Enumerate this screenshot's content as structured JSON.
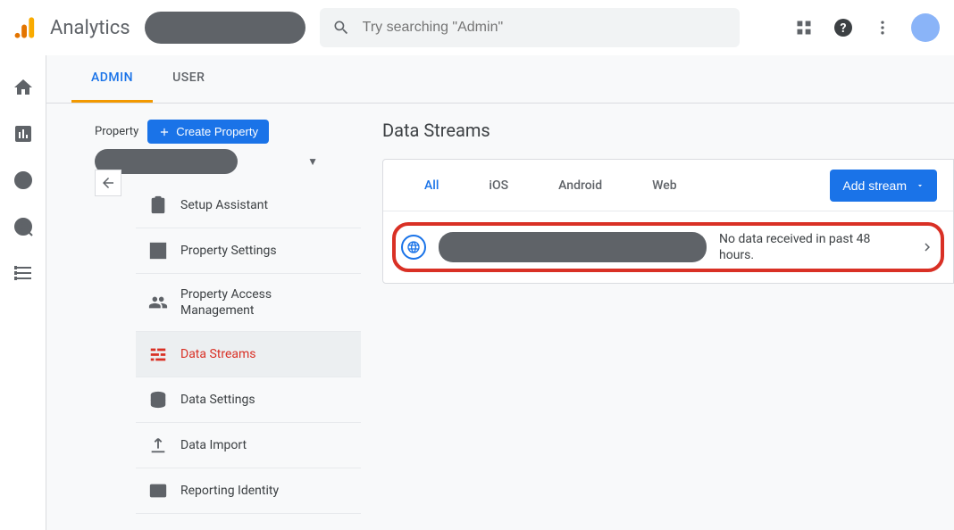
{
  "header": {
    "app_name": "Analytics",
    "search_placeholder": "Try searching \"Admin\""
  },
  "tabs": {
    "admin": "ADMIN",
    "user": "USER"
  },
  "property": {
    "label": "Property",
    "create_button": "Create Property",
    "menu": {
      "setup_assistant": "Setup Assistant",
      "property_settings": "Property Settings",
      "property_access": "Property Access Management",
      "data_streams": "Data Streams",
      "data_settings": "Data Settings",
      "data_import": "Data Import",
      "reporting_identity": "Reporting Identity"
    }
  },
  "content": {
    "title": "Data Streams",
    "stream_tabs": {
      "all": "All",
      "ios": "iOS",
      "android": "Android",
      "web": "Web"
    },
    "add_stream": "Add stream",
    "row_status": "No data received in past 48 hours."
  }
}
